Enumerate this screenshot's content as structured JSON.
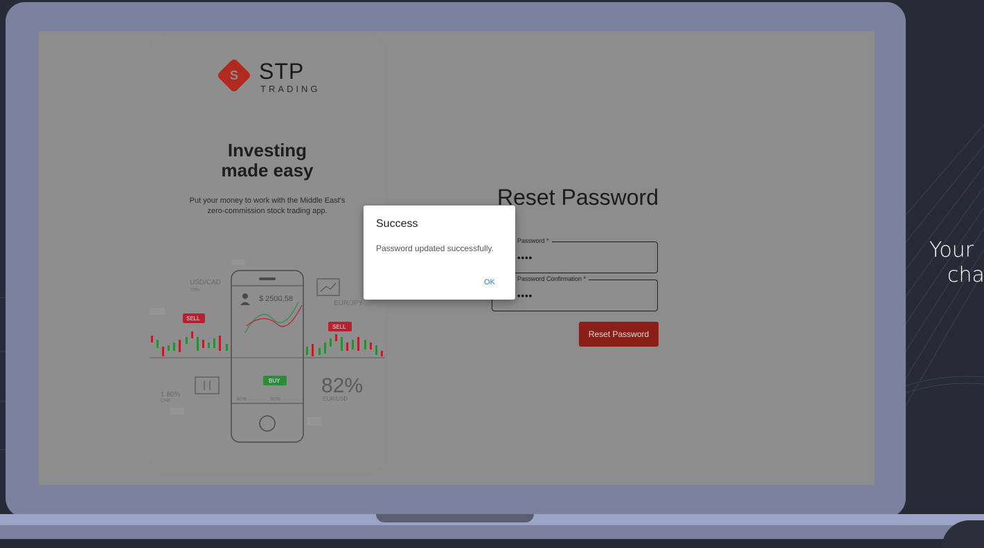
{
  "promo": {
    "brand": "STP",
    "brand_sub": "TRADING",
    "logo_mark": "S",
    "headline_line1": "Investing",
    "headline_line2": "made easy",
    "tagline": "Put your money to work with the Middle East's zero-commission stock trading app."
  },
  "promo_art": {
    "usdcad": "USD/CAD",
    "usdcad_pct": "70%",
    "sell1": "SELL",
    "sell2": "SELL",
    "buy": "BUY",
    "balance": "$ 2500,58",
    "eurjpy": "EUR/JPY",
    "pct_left": "1.80%",
    "chf": "CHF",
    "pct_40": "40%",
    "pct_60": "60%",
    "big_pct": "82%",
    "eurusd": "EUR/USD"
  },
  "form": {
    "title": "Reset Password",
    "password_label": "Password *",
    "password_value": "••••",
    "confirm_label": "Password Confirmation *",
    "confirm_value": "••••",
    "submit_label": "Reset Password"
  },
  "dialog": {
    "title": "Success",
    "message": "Password updated successfully.",
    "ok_label": "OK"
  },
  "side": {
    "line1": "Your",
    "line2": "cha"
  },
  "colors": {
    "accent": "#b02a20",
    "button": "#8a1f18",
    "ok": "#2d7fd8",
    "buy": "#2e8b3a",
    "sell": "#b8202f"
  }
}
